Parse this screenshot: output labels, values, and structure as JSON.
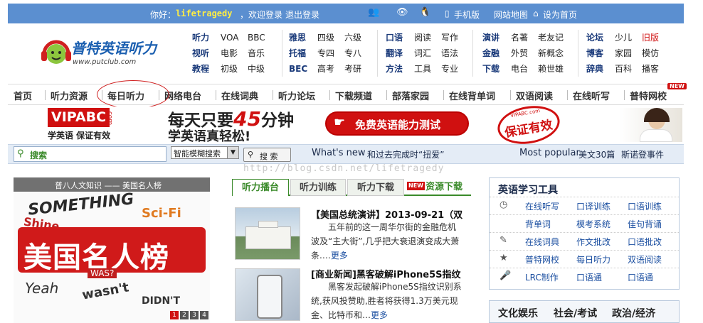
{
  "topbar": {
    "greeting": "你好：",
    "username": "lifetragedy",
    "welcome": "，欢迎登录",
    "logout": "退出登录",
    "mobile": "手机版",
    "sitemap": "网站地图",
    "homepage": "设为首页"
  },
  "logo": {
    "name": "普特英语听力",
    "url": "www.putclub.com"
  },
  "nav_cols": [
    [
      "听力",
      "视听",
      "教程"
    ],
    [
      "VOA",
      "电影",
      "初级"
    ],
    [
      "BBC",
      "音乐",
      "中级"
    ],
    [
      "雅思",
      "托福",
      "BEC"
    ],
    [
      "四级",
      "专四",
      "高考"
    ],
    [
      "六级",
      "专八",
      "考研"
    ],
    [
      "口语",
      "翻译",
      "方法"
    ],
    [
      "阅读",
      "词汇",
      "工具"
    ],
    [
      "写作",
      "语法",
      "专业"
    ],
    [
      "演讲",
      "金融",
      "下载"
    ],
    [
      "名著",
      "外贸",
      "电台"
    ],
    [
      "老友记",
      "新概念",
      "赖世雄"
    ],
    [
      "论坛",
      "博客",
      "辞典"
    ],
    [
      "少儿",
      "家园",
      "百科"
    ],
    [
      "旧版",
      "模仿",
      "播客"
    ]
  ],
  "mainnav": [
    "首页",
    "听力资源",
    "每日听力",
    "网络电台",
    "在线词典",
    "听力论坛",
    "下载频道",
    "部落家园",
    "在线背单词",
    "双语阅读",
    "在线听写",
    "普特网校"
  ],
  "new_badge": "NEW",
  "banner": {
    "brand": "VIPABC",
    "brand_suffix": ".com",
    "brand_sub": "学英语 保证有效",
    "headline_a": "每天只要",
    "headline_num": "45",
    "headline_b": "分钟",
    "subline": "学英语真轻松!",
    "cta": "免费英语能力测试",
    "stamp": "保证有效",
    "stamp_top": "VIPABC.com"
  },
  "search": {
    "placeholder": "搜索",
    "mode": "智能模糊搜索",
    "button": "搜 索",
    "whatsnew": "What's new",
    "whatsnew_text": "和过去完成时“扭爱”",
    "popular": "Most popular",
    "popular_1": "美文30篇",
    "popular_2": "斯诺登事件"
  },
  "watermark": "http://blog.csdn.net/lifetragedy",
  "leftimg": {
    "caption": "普八人文知识 —— 美国名人榜",
    "title": "美国名人榜",
    "pager": [
      "1",
      "2",
      "3",
      "4"
    ]
  },
  "tabs": [
    "听力播台",
    "听力训练",
    "听力下载",
    "资源下载"
  ],
  "tab_badge": "NEW",
  "news": [
    {
      "title": "【美国总统演讲】2013-09-21（双",
      "body": "五年前的这一周华尔街的金融危机波及“主大街”,几乎把大衰退演变成大萧条.…",
      "more": "更多"
    },
    {
      "title": "[商业新闻]黑客破解iPhone5S指纹",
      "body": "黑客发起破解iPhone5S指纹识别系统,获风投赞助,胜者将获得1.3万美元现金、比特币和…",
      "more": "更多"
    }
  ],
  "tools": {
    "title": "英语学习工具",
    "rows": [
      {
        "icon": "clock-icon",
        "items": [
          "在线听写",
          "口译训练",
          "口语训练"
        ]
      },
      {
        "icon": "",
        "items": [
          "背单词",
          "模考系统",
          "佳句背诵"
        ]
      },
      {
        "icon": "edit-icon",
        "items": [
          "在线词典",
          "作文批改",
          "口语批改"
        ]
      },
      {
        "icon": "star-icon",
        "items": [
          "普特网校",
          "每日听力",
          "双语阅读"
        ]
      },
      {
        "icon": "mic-icon",
        "items": [
          "LRC制作",
          "口语通",
          "口语通"
        ]
      }
    ]
  },
  "bottomtabs": [
    "文化娱乐",
    "社会/考试",
    "政治/经济"
  ],
  "colors": {
    "topbar": "#5b8fd0",
    "nav_green": "#3a8a2a",
    "accent_red": "#d01010"
  }
}
